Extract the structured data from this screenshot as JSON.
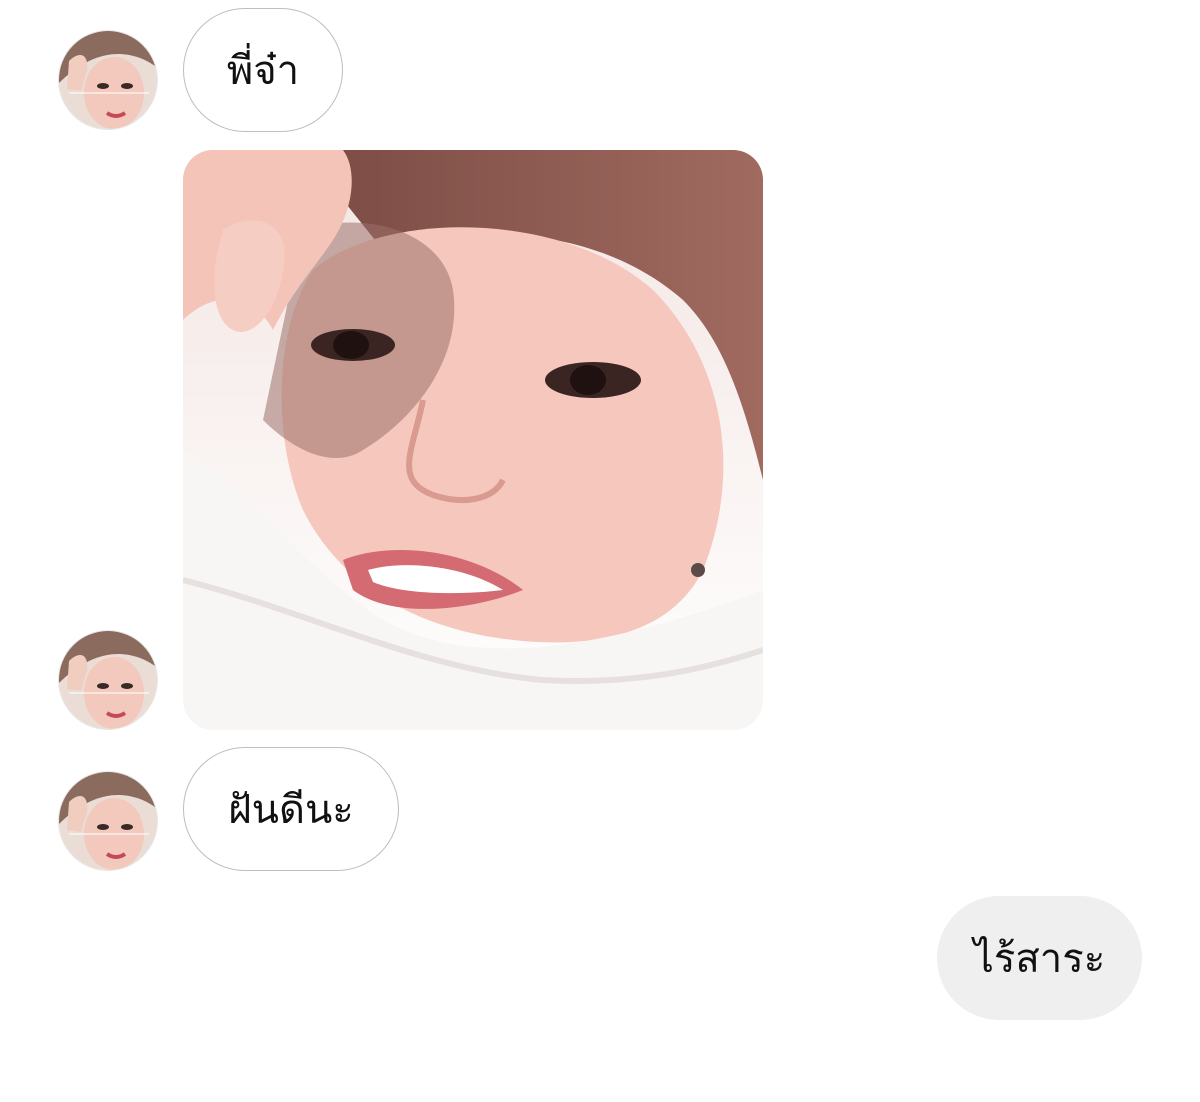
{
  "conversation": {
    "messages": [
      {
        "sender": "contact",
        "type": "text",
        "text": "พี่จ๋า"
      },
      {
        "sender": "contact",
        "type": "photo",
        "icon": "selfie-photo"
      },
      {
        "sender": "contact",
        "type": "text",
        "text": "ฝันดีนะ"
      },
      {
        "sender": "me",
        "type": "text",
        "text": "ไร้สาระ"
      }
    ]
  },
  "colors": {
    "incoming_bubble_border": "#bdbdbd",
    "outgoing_bubble_bg": "#efefef",
    "background": "#ffffff"
  }
}
